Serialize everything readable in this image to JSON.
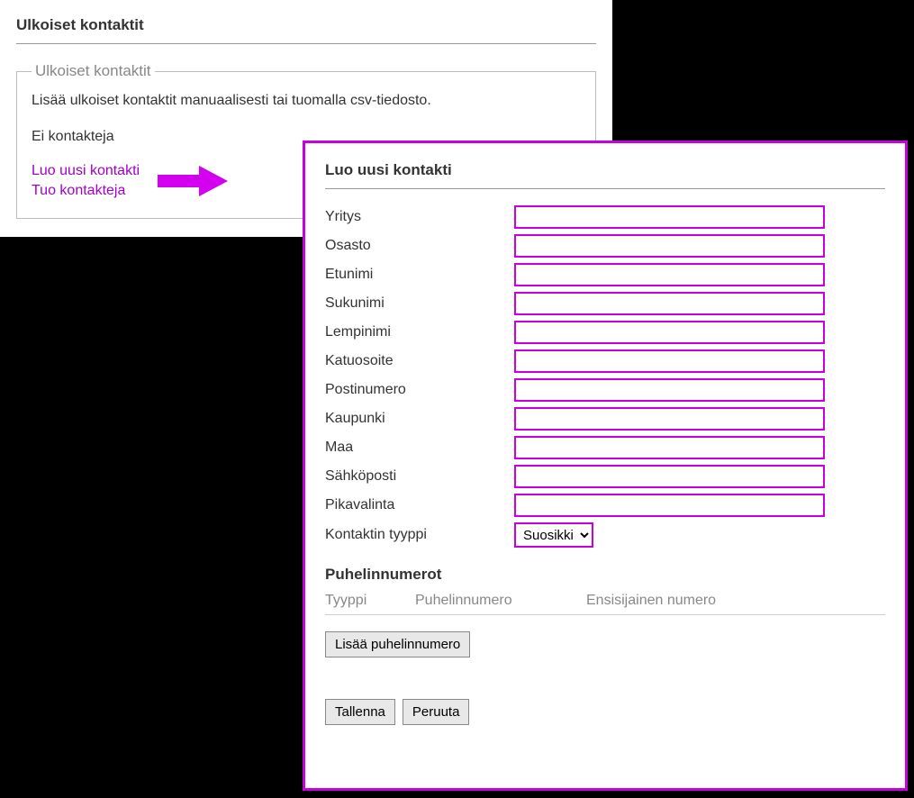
{
  "left": {
    "title": "Ulkoiset kontaktit",
    "fieldset_legend": "Ulkoiset kontaktit",
    "help_text": "Lisää ulkoiset kontaktit manuaalisesti tai tuomalla csv-tiedosto.",
    "no_contacts": "Ei kontakteja",
    "link_create": "Luo uusi kontakti",
    "link_import": "Tuo kontakteja"
  },
  "right": {
    "title": "Luo uusi kontakti",
    "fields": {
      "company": "Yritys",
      "department": "Osasto",
      "firstname": "Etunimi",
      "lastname": "Sukunimi",
      "nickname": "Lempinimi",
      "street": "Katuosoite",
      "postalcode": "Postinumero",
      "city": "Kaupunki",
      "country": "Maa",
      "email": "Sähköposti",
      "speeddial": "Pikavalinta",
      "contact_type": "Kontaktin tyyppi"
    },
    "contact_type_value": "Suosikki",
    "phones": {
      "heading": "Puhelinnumerot",
      "col_type": "Tyyppi",
      "col_number": "Puhelinnumero",
      "col_primary": "Ensisijainen numero",
      "add_button": "Lisää puhelinnumero"
    },
    "save": "Tallenna",
    "cancel": "Peruuta"
  }
}
